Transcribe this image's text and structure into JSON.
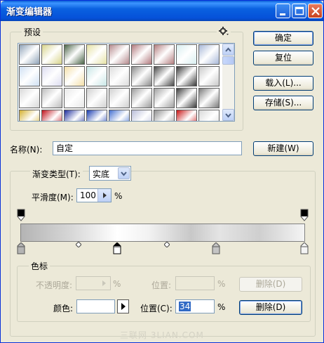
{
  "window": {
    "title": "渐变编辑器",
    "controls": {
      "minimize": "minimize-icon",
      "maximize": "maximize-icon",
      "close": "close-icon"
    }
  },
  "presets": {
    "legend": "预设",
    "menu_icon": "gear-icon",
    "swatch_colors": [
      [
        "#8fa3b8",
        "#d8d48a",
        "#4b6548",
        "#e6e2a4",
        "#b58a8d",
        "#b27a7e",
        "#b47e7f",
        "#d8eef0",
        "#a8b8d8"
      ],
      [
        "#cfe0f3",
        "#dcdcf0",
        "#f4dfa8",
        "#c8e6e6",
        "#dcdcdc",
        "#8a8a8a",
        "#4a4a4a",
        "#3a3a3a",
        "#c8c8c8"
      ],
      [
        "#d8d8d8",
        "#bcbcbc",
        "#e8e8e8",
        "#d0d0d0",
        "#cfcfcf",
        "#9a9a9a",
        "#a0a0a0",
        "#3c3c3c",
        "#7a7a7a"
      ],
      [
        "#d4b030",
        "#c0101a",
        "#1c2c9c",
        "#1a3cb0",
        "#4470d0",
        "#b8bcd8",
        "#909090",
        "#c81414",
        "#d8d8d8"
      ]
    ]
  },
  "buttons": {
    "ok": "确定",
    "reset": "复位",
    "load": "载入(L)...",
    "save": "存储(S)...",
    "new": "新建(W)"
  },
  "name": {
    "label": "名称(N):",
    "value": "自定"
  },
  "gradient": {
    "type_label": "渐变类型(T):",
    "type_value": "实底",
    "smoothness_label": "平滑度(M):",
    "smoothness_value": "100",
    "smoothness_unit": "%"
  },
  "stops": {
    "legend": "色标",
    "opacity_label": "不透明度:",
    "opacity_value": "",
    "opacity_unit": "%",
    "opacity_location_label": "位置:",
    "opacity_location_value": "",
    "opacity_location_unit": "%",
    "opacity_delete": "删除(D)",
    "color_label": "颜色:",
    "color_swatch": "#ffffff",
    "color_location_label": "位置(C):",
    "color_location_value": "34",
    "color_location_unit": "%",
    "color_delete": "删除(D)"
  },
  "watermark": "三联网 3LIAN.COM"
}
